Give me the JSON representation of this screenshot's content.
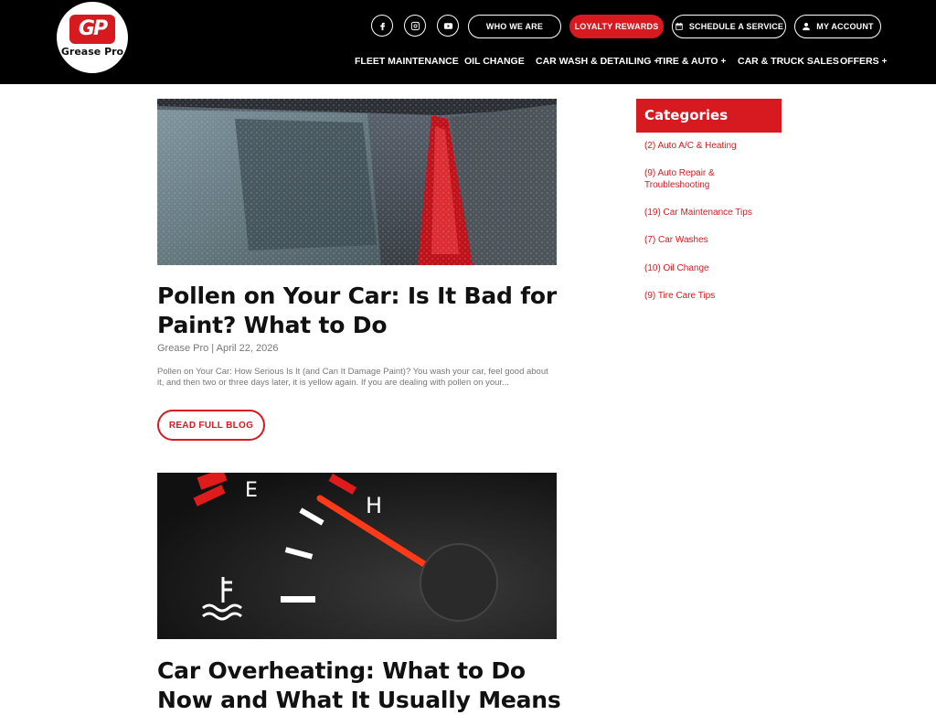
{
  "brand": {
    "logo_mark": "GP",
    "logo_text": "Grease Pro"
  },
  "header": {
    "social": [
      {
        "name": "facebook-icon"
      },
      {
        "name": "instagram-icon"
      },
      {
        "name": "youtube-icon"
      }
    ],
    "top_buttons": {
      "who_we_are": "WHO WE ARE",
      "loyalty": "LOYALTY REWARDS",
      "schedule": "SCHEDULE A SERVICE",
      "account": "MY ACCOUNT"
    },
    "nav": [
      {
        "label": "FLEET MAINTENANCE",
        "plus": ""
      },
      {
        "label": "OIL CHANGE",
        "plus": ""
      },
      {
        "label": "CAR WASH & DETAILING",
        "plus": "+"
      },
      {
        "label": "TIRE & AUTO",
        "plus": "+"
      },
      {
        "label": "CAR & TRUCK SALES",
        "plus": ""
      },
      {
        "label": "OFFERS",
        "plus": "+"
      }
    ]
  },
  "posts": [
    {
      "title": "Pollen on Your Car: Is It Bad for Paint? What to Do",
      "meta": "Grease Pro | April 22, 2026",
      "excerpt": "Pollen on Your Car: How Serious Is It (and Can It Damage Paint)? You wash your car, feel good about it, and then two or three days later, it is yellow again. If you are dealing with pollen on your...",
      "button": "READ FULL BLOG"
    },
    {
      "title": "Car Overheating: What to Do Now and What It Usually Means"
    }
  ],
  "sidebar": {
    "heading": "Categories",
    "categories": [
      "(2) Auto A/C & Heating",
      "(9) Auto Repair & Troubleshooting",
      "(19) Car Maintenance Tips",
      "(7) Car Washes",
      "(10) Oil Change",
      "(9) Tire Care Tips"
    ]
  },
  "colors": {
    "brand_red": "#d71920",
    "header_bg": "#000000"
  }
}
